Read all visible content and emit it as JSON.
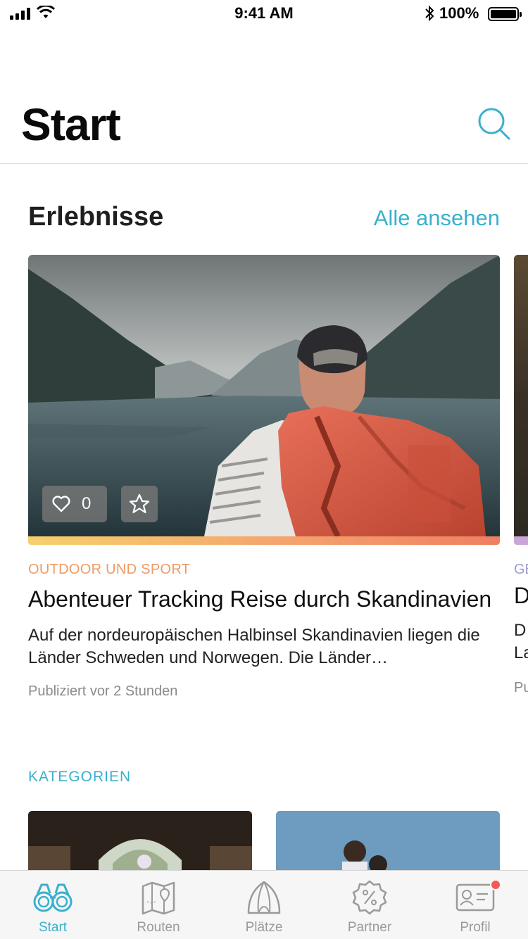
{
  "status_bar": {
    "time": "9:41 AM",
    "battery": "100%"
  },
  "header": {
    "title": "Start"
  },
  "experiences": {
    "title": "Erlebnisse",
    "see_all": "Alle ansehen",
    "cards": [
      {
        "category": "OUTDOOR UND SPORT",
        "title": "Abenteuer Tracking Reise durch Skandinavien",
        "description": "Auf der nordeuropäischen Halbinsel Skandinavien liegen die Länder Schweden und Norwegen. Die Länder…",
        "published": "Publiziert vor 2 Stunden",
        "likes": "0"
      },
      {
        "category": "GE",
        "title": "D",
        "description_line1": "D",
        "description_line2": "La",
        "published": "Pu"
      }
    ]
  },
  "categories": {
    "heading": "KATEGORIEN"
  },
  "tab_bar": {
    "tabs": [
      {
        "label": "Start",
        "icon": "binoculars-icon"
      },
      {
        "label": "Routen",
        "icon": "map-icon"
      },
      {
        "label": "Plätze",
        "icon": "tent-icon"
      },
      {
        "label": "Partner",
        "icon": "discount-badge-icon"
      },
      {
        "label": "Profil",
        "icon": "id-card-icon"
      }
    ]
  },
  "colors": {
    "accent": "#3ab0cc",
    "category_orange": "#f09a63",
    "badge_red": "#f25a5a"
  }
}
